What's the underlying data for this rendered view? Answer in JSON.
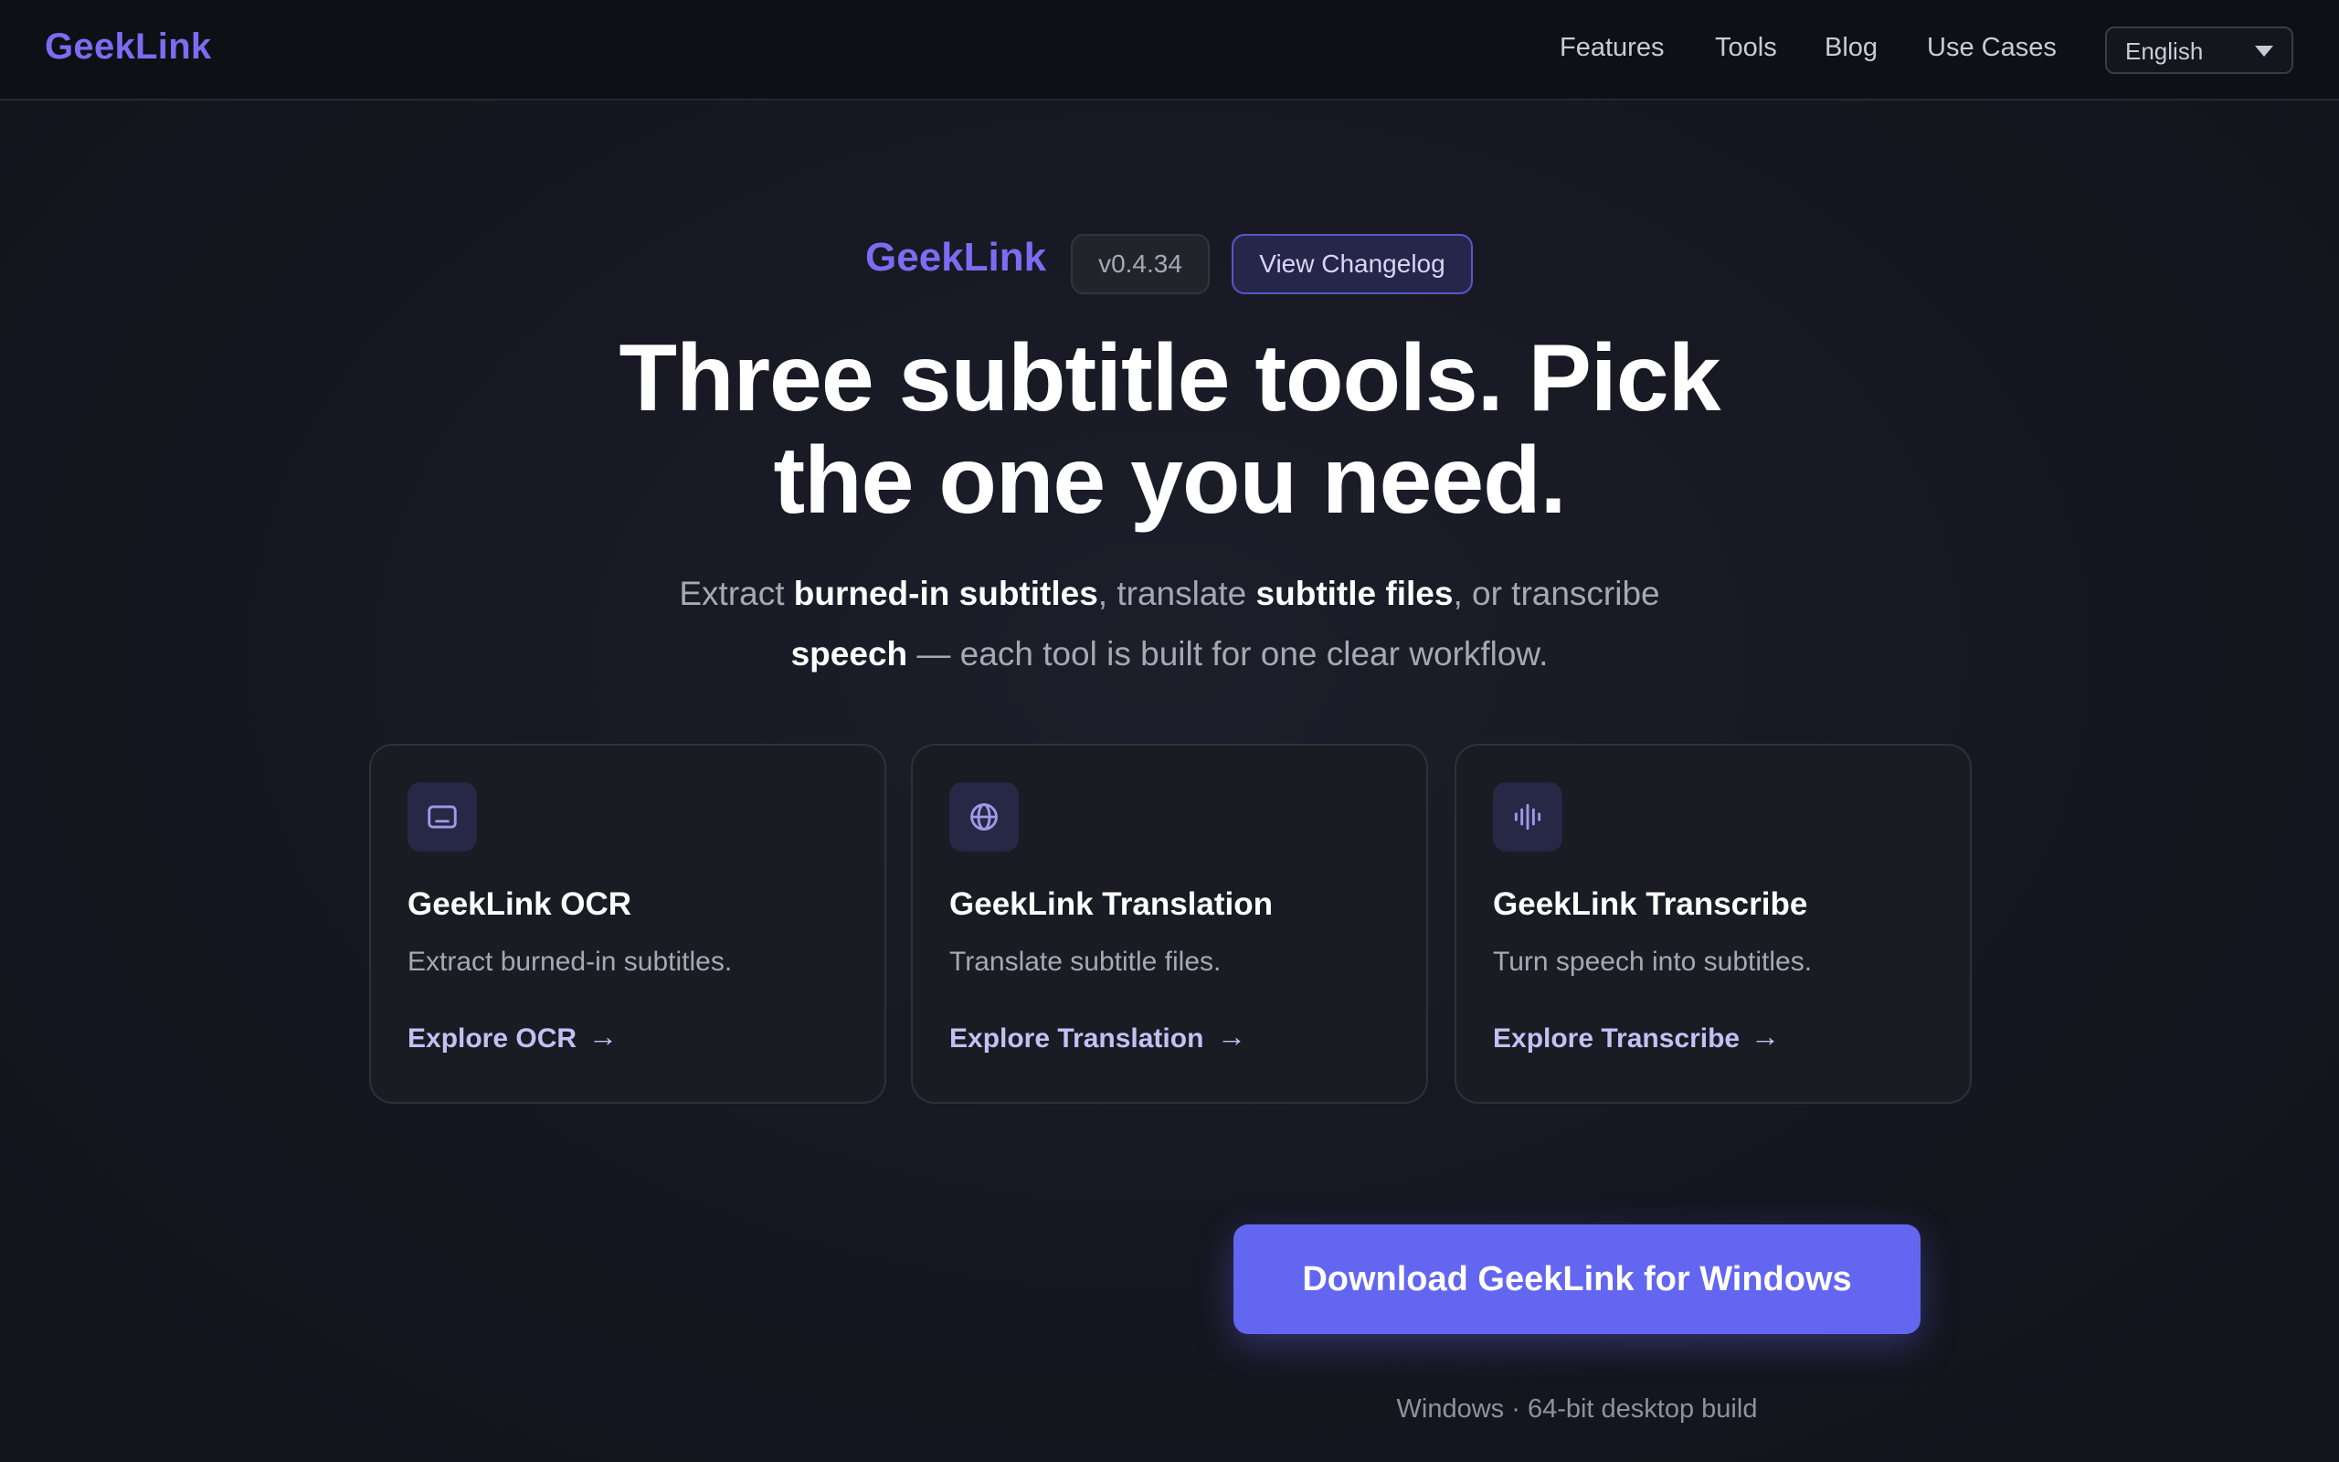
{
  "header": {
    "logo": "GeekLink",
    "nav": [
      "Features",
      "Tools",
      "Blog",
      "Use Cases"
    ],
    "language": "English"
  },
  "hero": {
    "brand": "GeekLink",
    "version": "v0.4.34",
    "changelog_label": "View Changelog",
    "headline_line1": "Three subtitle tools. Pick",
    "headline_line2": "the one you need.",
    "sub": {
      "t1": "Extract ",
      "b1": "burned-in subtitles",
      "t2": ", translate ",
      "b2": "subtitle files",
      "t3": ", or transcribe",
      "b3": "speech",
      "t4": " — each tool is built for one clear workflow."
    }
  },
  "cards": [
    {
      "icon": "subtitle-box-icon",
      "title": "GeekLink OCR",
      "desc": "Extract burned-in subtitles.",
      "link": "Explore OCR",
      "arrow": "→"
    },
    {
      "icon": "globe-icon",
      "title": "GeekLink Translation",
      "desc": "Translate subtitle files.",
      "link": "Explore Translation",
      "arrow": "→"
    },
    {
      "icon": "waveform-icon",
      "title": "GeekLink Transcribe",
      "desc": "Turn speech into subtitles.",
      "link": "Explore Transcribe",
      "arrow": "→"
    }
  ],
  "cta": {
    "download_label": "Download GeekLink for Windows",
    "note": "Windows · 64-bit desktop build"
  },
  "colors": {
    "accent": "#6366f1",
    "brand": "#7c6cf2",
    "background": "#15161f"
  }
}
